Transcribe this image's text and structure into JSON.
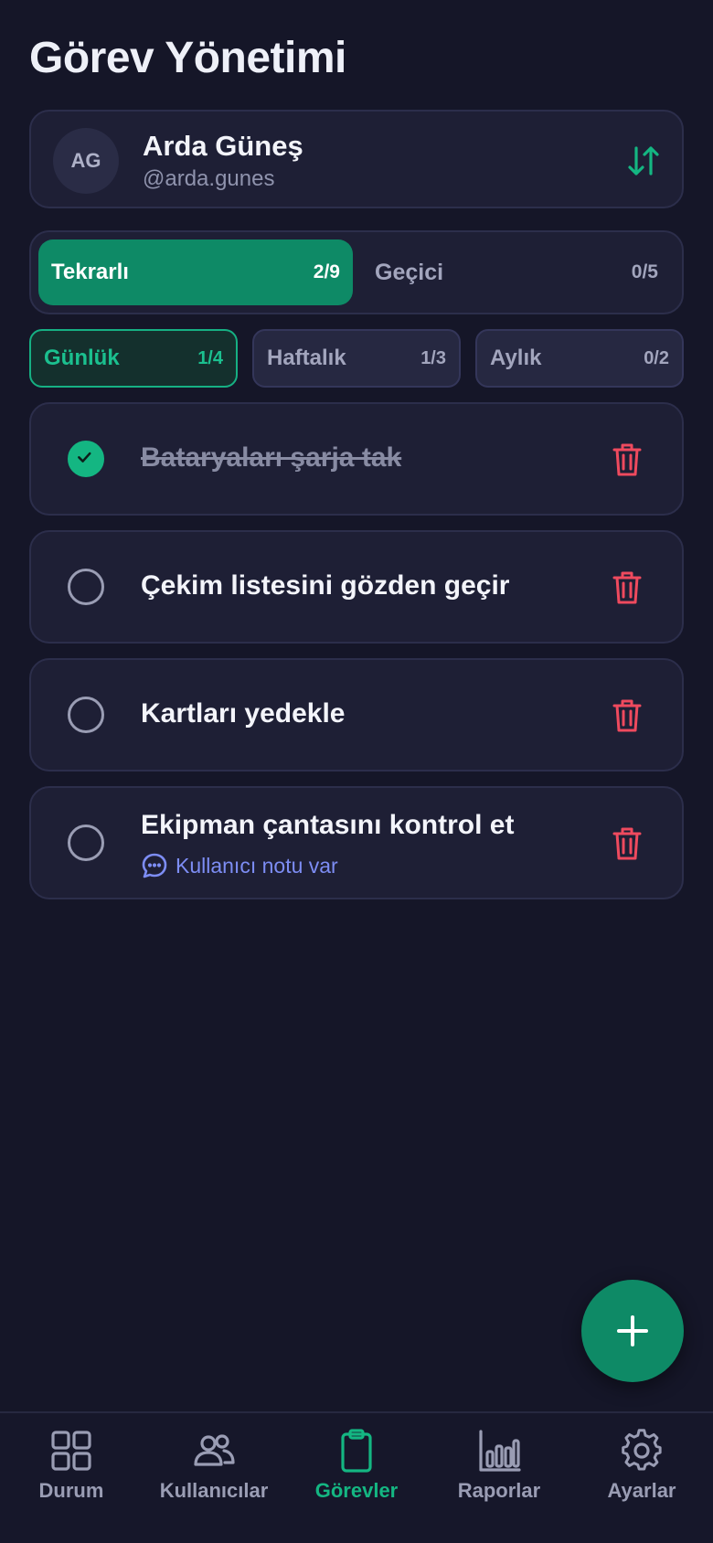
{
  "page": {
    "title": "Görev Yönetimi"
  },
  "user": {
    "initials": "AG",
    "name": "Arda Güneş",
    "handle": "@arda.gunes"
  },
  "type_tabs": [
    {
      "label": "Tekrarlı",
      "count": "2/9",
      "active": true
    },
    {
      "label": "Geçici",
      "count": "0/5",
      "active": false
    }
  ],
  "period_tabs": [
    {
      "label": "Günlük",
      "count": "1/4",
      "active": true
    },
    {
      "label": "Haftalık",
      "count": "1/3",
      "active": false
    },
    {
      "label": "Aylık",
      "count": "0/2",
      "active": false
    }
  ],
  "tasks": [
    {
      "title": "Bataryaları şarja tak",
      "done": true
    },
    {
      "title": "Çekim listesini gözden geçir",
      "done": false
    },
    {
      "title": "Kartları yedekle",
      "done": false
    },
    {
      "title": "Ekipman çantasını kontrol et",
      "done": false,
      "note": "Kullanıcı notu var"
    }
  ],
  "nav": [
    {
      "label": "Durum",
      "icon": "grid-icon",
      "active": false
    },
    {
      "label": "Kullanıcılar",
      "icon": "users-icon",
      "active": false
    },
    {
      "label": "Görevler",
      "icon": "clipboard-icon",
      "active": true
    },
    {
      "label": "Raporlar",
      "icon": "bar-chart-icon",
      "active": false
    },
    {
      "label": "Ayarlar",
      "icon": "gear-icon",
      "active": false
    }
  ],
  "colors": {
    "background": "#151628",
    "card": "#1e1f35",
    "accent": "#0e8a66",
    "accent_light": "#14b682",
    "danger": "#ef4a5e",
    "link": "#7d8df4"
  }
}
